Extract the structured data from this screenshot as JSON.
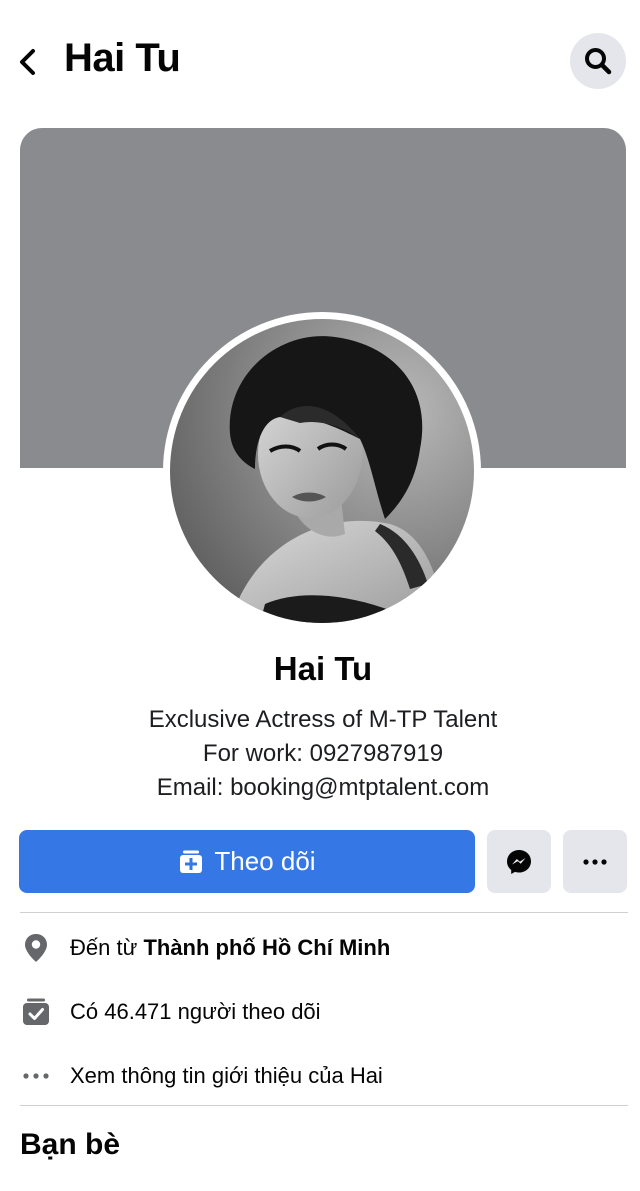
{
  "header": {
    "title": "Hai Tu"
  },
  "profile": {
    "name": "Hai Tu",
    "bio": [
      "Exclusive Actress of M-TP Talent",
      "For work: 0927987919",
      "Email: booking@mtptalent.com"
    ]
  },
  "actions": {
    "follow_label": "Theo dõi"
  },
  "details": {
    "location_prefix": "Đến từ ",
    "location_value": "Thành phố Hồ Chí Minh",
    "followers": "Có 46.471 người theo dõi",
    "about": "Xem thông tin giới thiệu của Hai"
  },
  "friends": {
    "title": "Bạn bè"
  },
  "colors": {
    "primary": "#3578e5",
    "secondary_button": "#e4e6eb",
    "cover": "#8a8b8f",
    "icon": "#65676b"
  },
  "icons": [
    "back-chevron",
    "search",
    "follow-plus",
    "messenger",
    "more-dots",
    "location-pin",
    "followers",
    "more-dots"
  ]
}
